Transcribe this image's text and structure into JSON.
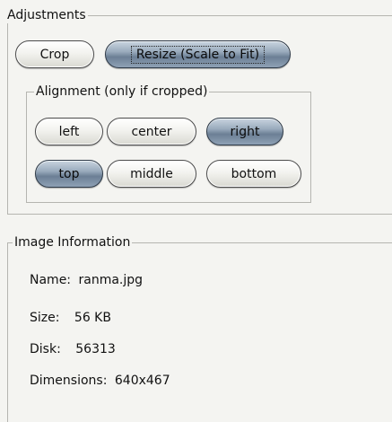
{
  "adjustments": {
    "legend": "Adjustments",
    "crop_label": "Crop",
    "resize_label": "Resize (Scale to Fit)"
  },
  "alignment": {
    "legend": "Alignment (only if cropped)",
    "left_label": "left",
    "center_label": "center",
    "right_label": "right",
    "top_label": "top",
    "middle_label": "middle",
    "bottom_label": "bottom"
  },
  "image_info": {
    "legend": "Image Information",
    "name_label": "Name:",
    "name_value": "ranma.jpg",
    "size_label": "Size:",
    "size_value": "56 KB",
    "disk_label": "Disk:",
    "disk_value": "56313",
    "dimensions_label": "Dimensions:",
    "dimensions_value": "640x467"
  },
  "colors": {
    "selected_button": "#7d8fa5",
    "button_border": "#4b4b4b",
    "background": "#f4f4f1"
  }
}
